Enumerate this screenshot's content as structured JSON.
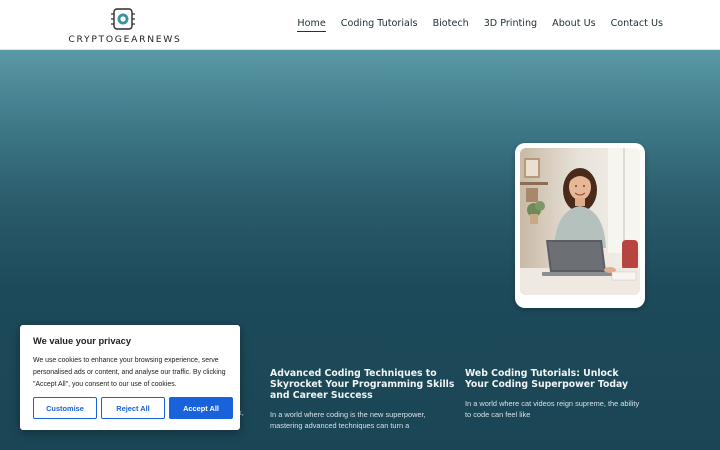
{
  "header": {
    "logo_text": "CRYPTOGEARNEWS",
    "logo_icon": "circuit-coin-icon",
    "nav": [
      {
        "label": "Home",
        "active": true
      },
      {
        "label": "Coding Tutorials"
      },
      {
        "label": "Biotech"
      },
      {
        "label": "3D Printing"
      },
      {
        "label": "About Us"
      },
      {
        "label": "Contact Us"
      }
    ]
  },
  "hero": {
    "image": "woman-with-laptop-photo"
  },
  "articles": [
    {
      "title": "Advanced Coding Techniques to Skyrocket Your Programming Skills and Career Success",
      "excerpt": "In a world where coding is the new superpower, mastering advanced techniques can turn a"
    },
    {
      "title": "Web Coding Tutorials: Unlock Your Coding Superpower Today",
      "excerpt": "In a world where cat videos reign supreme, the ability to code can feel like"
    }
  ],
  "partial_text": "k,",
  "cookie_banner": {
    "title": "We value your privacy",
    "body": "We use cookies to enhance your browsing experience, serve personalised ads or content, and analyse our traffic. By clicking \"Accept All\", you consent to our use of cookies.",
    "customise": "Customise",
    "reject": "Reject All",
    "accept": "Accept All"
  },
  "colors": {
    "accent": "#1863dc",
    "hero_top": "#5a99a6",
    "hero_bottom": "#1a4555"
  }
}
